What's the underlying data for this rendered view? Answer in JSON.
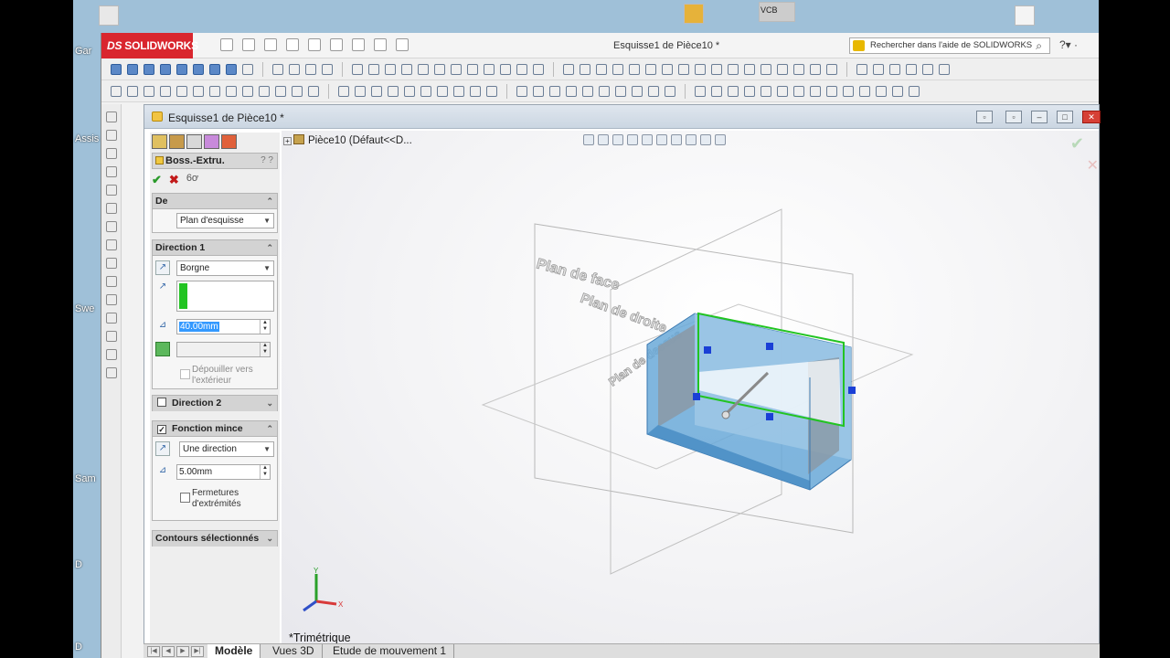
{
  "app": {
    "brand": "SOLIDWORKS",
    "window_title": "Esquisse1 de Pièce10 *",
    "search_placeholder": "Rechercher dans l'aide de SOLIDWORKS"
  },
  "desktop": {
    "icon_labels": [
      "Gar",
      "Assis niveau",
      "Swe",
      "Sam",
      "D",
      "D"
    ],
    "top_icon_label": "VCB"
  },
  "document": {
    "title": "Esquisse1 de Pièce10 *",
    "tree_path": "Pièce10  (Défaut<<D..."
  },
  "property_manager": {
    "feature_title": "Boss.-Extru.",
    "sections": {
      "from": {
        "header": "De",
        "value": "Plan d'esquisse"
      },
      "direction1": {
        "header": "Direction 1",
        "end_condition": "Borgne",
        "depth": "40.00mm",
        "draft_label": "Dépouiller vers l'extérieur"
      },
      "direction2": {
        "header": "Direction 2"
      },
      "thin": {
        "header": "Fonction mince",
        "type": "Une direction",
        "thickness": "5.00mm",
        "cap_label": "Fermetures d'extrémités"
      },
      "contours": {
        "header": "Contours sélectionnés"
      }
    }
  },
  "viewport": {
    "plane_front": "Plan de face",
    "plane_right": "Plan de droite",
    "plane_top": "Plan de dessus",
    "view_orientation": "*Trimétrique",
    "axis_x": "X",
    "axis_y": "Y"
  },
  "bottom_tabs": [
    "Modèle",
    "Vues 3D",
    "Etude de mouvement 1"
  ],
  "colors": {
    "brand_red": "#d9262e",
    "part_blue": "#4f9fd6",
    "sketch_green": "#22c422",
    "handle_blue": "#1a3fd6"
  }
}
